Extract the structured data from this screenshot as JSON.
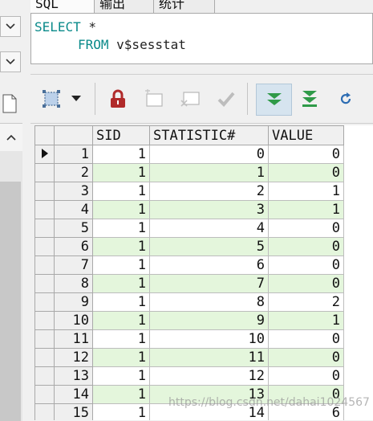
{
  "tabs": [
    {
      "label": "SQL",
      "active": true
    },
    {
      "label": "输出",
      "active": false
    },
    {
      "label": "统计",
      "active": false
    },
    {
      "label": "",
      "active": false
    }
  ],
  "editor": {
    "line1_keyword": "SELECT",
    "line1_rest": " *",
    "line2_keyword": "FROM",
    "line2_rest": " v$sesstat"
  },
  "toolbar": {
    "icons": [
      "grid-select-icon",
      "dropdown-arrow-icon",
      "lock-icon",
      "insert-record-icon",
      "delete-record-icon",
      "post-edit-icon",
      "fetch-next-page-icon",
      "fetch-last-page-icon",
      "refresh-icon"
    ]
  },
  "grid": {
    "columns": [
      "SID",
      "STATISTIC#",
      "VALUE"
    ],
    "rows": [
      {
        "n": "1",
        "sid": "1",
        "stat": "0",
        "value": "0"
      },
      {
        "n": "2",
        "sid": "1",
        "stat": "1",
        "value": "0"
      },
      {
        "n": "3",
        "sid": "1",
        "stat": "2",
        "value": "1"
      },
      {
        "n": "4",
        "sid": "1",
        "stat": "3",
        "value": "1"
      },
      {
        "n": "5",
        "sid": "1",
        "stat": "4",
        "value": "0"
      },
      {
        "n": "6",
        "sid": "1",
        "stat": "5",
        "value": "0"
      },
      {
        "n": "7",
        "sid": "1",
        "stat": "6",
        "value": "0"
      },
      {
        "n": "8",
        "sid": "1",
        "stat": "7",
        "value": "0"
      },
      {
        "n": "9",
        "sid": "1",
        "stat": "8",
        "value": "2"
      },
      {
        "n": "10",
        "sid": "1",
        "stat": "9",
        "value": "1"
      },
      {
        "n": "11",
        "sid": "1",
        "stat": "10",
        "value": "0"
      },
      {
        "n": "12",
        "sid": "1",
        "stat": "11",
        "value": "0"
      },
      {
        "n": "13",
        "sid": "1",
        "stat": "12",
        "value": "0"
      },
      {
        "n": "14",
        "sid": "1",
        "stat": "13",
        "value": "0"
      },
      {
        "n": "15",
        "sid": "1",
        "stat": "14",
        "value": "6"
      }
    ]
  },
  "watermark": "https://blog.csdn.net/dahai1024567",
  "colors": {
    "keyword": "#0a8a8a",
    "alt_row": "#e4f6dc",
    "lock_red": "#b02a2a",
    "fetch_green": "#2f9a48",
    "refresh_blue": "#2d6db3"
  }
}
